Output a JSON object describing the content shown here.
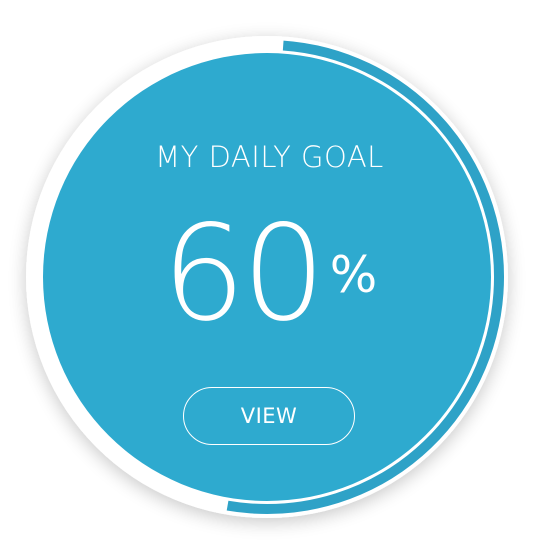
{
  "goal": {
    "title": "MY DAILY GOAL",
    "value": "60",
    "unit": "%",
    "progress": 0.6
  },
  "actions": {
    "view_label": "VIEW"
  },
  "colors": {
    "disc": "#2eaacf",
    "ring_track": "#ffffff",
    "ring_progress": "#2ea2c7",
    "text": "#ffffff"
  }
}
